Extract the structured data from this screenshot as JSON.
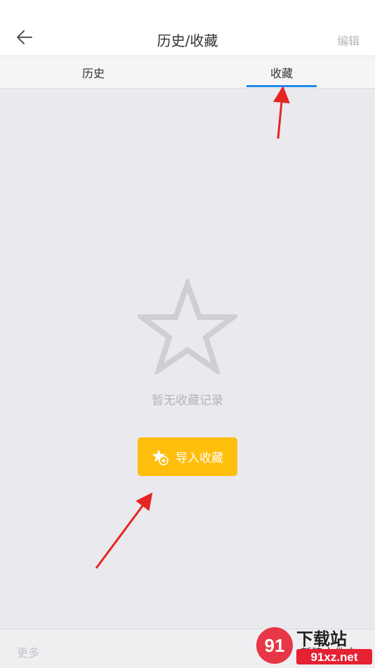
{
  "header": {
    "back_icon": "arrow-left-icon",
    "title": "历史/收藏",
    "edit_label": "编辑"
  },
  "tabs": [
    {
      "label": "历史",
      "active": false
    },
    {
      "label": "收藏",
      "active": true
    }
  ],
  "empty_state": {
    "icon": "star-outline-icon",
    "text": "暂无收藏记录"
  },
  "import_button": {
    "icon": "star-plus-icon",
    "label": "导入收藏"
  },
  "footer": {
    "more_label": "更多",
    "new_folder_label": "新建文件夹"
  },
  "watermark": {
    "text_top": "下载站",
    "text_bottom": "91xz.net"
  },
  "colors": {
    "accent_blue": "#1e88e5",
    "button_yellow": "#ffbe0b",
    "background": "#e9e9ee",
    "annotation_red": "#e52424"
  }
}
